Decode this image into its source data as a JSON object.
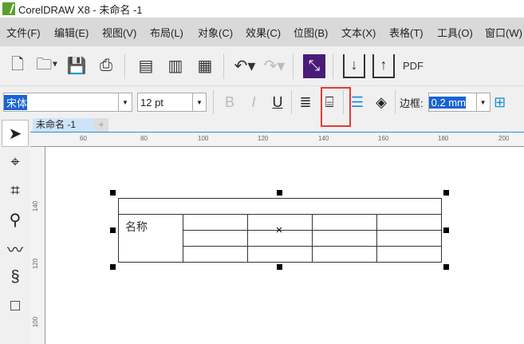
{
  "title": "CorelDRAW X8 - 未命名 -1",
  "menu": [
    "文件(F)",
    "编辑(E)",
    "视图(V)",
    "布局(L)",
    "对象(C)",
    "效果(C)",
    "位图(B)",
    "文本(X)",
    "表格(T)",
    "工具(O)",
    "窗口(W)"
  ],
  "toolbar": {
    "pdf_label": "PDF"
  },
  "propbar": {
    "font": "宋体",
    "size": "12 pt",
    "bold": "B",
    "italic": "I",
    "underline": "U",
    "border_label": "边框:",
    "border_width": "0.2 mm"
  },
  "document": {
    "tab": "未命名 -1",
    "add_tab": "+"
  },
  "ruler": {
    "h": [
      "60",
      "80",
      "100",
      "120",
      "140",
      "160",
      "180",
      "200"
    ],
    "v": [
      "140",
      "120",
      "100"
    ]
  },
  "table": {
    "cell_text": "名称"
  },
  "colors": {
    "accent": "#1a64d2",
    "highlight": "#e53935",
    "menu_bg": "#d9d9d9"
  }
}
